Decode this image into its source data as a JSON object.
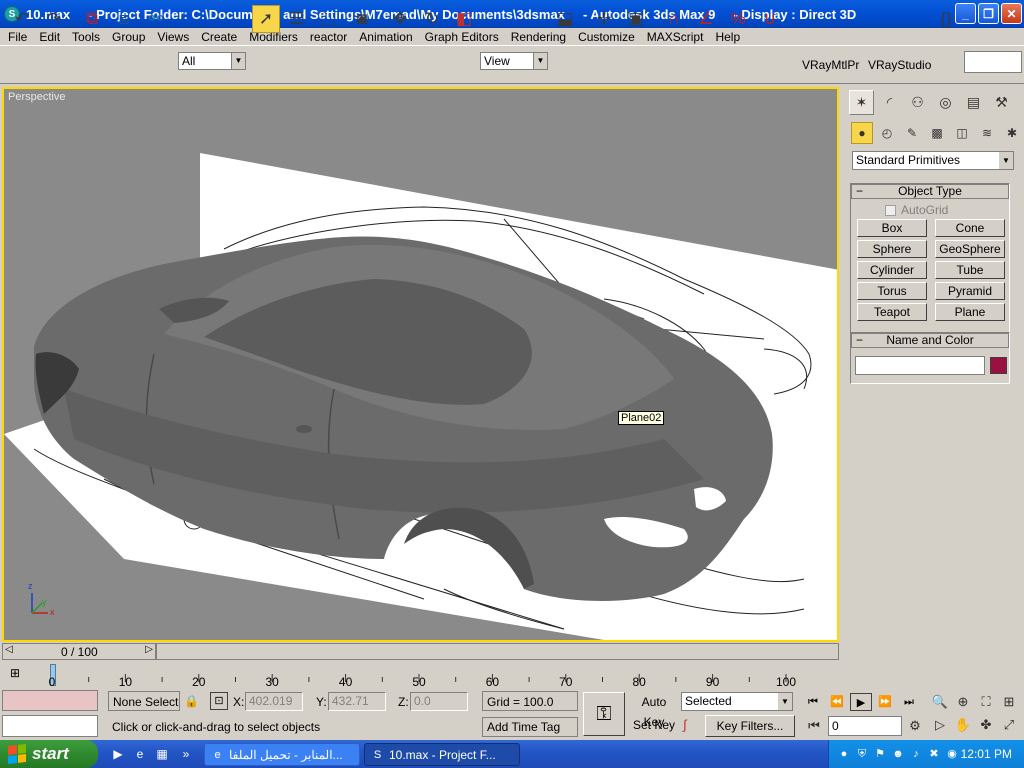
{
  "window": {
    "title": "10.max     - Project Folder: C:\\Documents and Settings\\M7emad\\My Documents\\3dsmax     - Autodesk 3ds Max 9     - Display : Direct 3D",
    "icon": "3dsmax-icon",
    "minimize": "_",
    "maximize": "❐",
    "close": "✕"
  },
  "menu": [
    "File",
    "Edit",
    "Tools",
    "Group",
    "Views",
    "Create",
    "Modifiers",
    "reactor",
    "Animation",
    "Graph Editors",
    "Rendering",
    "Customize",
    "MAXScript",
    "Help"
  ],
  "toolbar": {
    "selection_filter": "All",
    "reference_coord": "View",
    "vray_mtl": "VRayMtlPr",
    "vray_studio": "VRayStudio"
  },
  "viewport": {
    "label": "Perspective",
    "tooltip": "Plane02",
    "axis": {
      "z": "z",
      "y": "y",
      "x": "x"
    }
  },
  "command_panel": {
    "category": "Standard Primitives",
    "object_type": {
      "title": "Object Type",
      "autogrid": "AutoGrid",
      "buttons": [
        "Box",
        "Cone",
        "Sphere",
        "GeoSphere",
        "Cylinder",
        "Tube",
        "Torus",
        "Pyramid",
        "Teapot",
        "Plane"
      ]
    },
    "name_color": {
      "title": "Name and Color",
      "color": "#9a1040"
    }
  },
  "timeline": {
    "slider": "0 / 100",
    "ticks": [
      0,
      10,
      20,
      30,
      40,
      50,
      60,
      70,
      80,
      90,
      100
    ]
  },
  "status": {
    "selection": "None Selecte",
    "x_label": "X:",
    "x": "402.019",
    "y_label": "Y:",
    "y": "432.71",
    "z_label": "Z:",
    "z": "0.0",
    "grid": "Grid = 100.0",
    "prompt": "Click or click-and-drag to select objects",
    "add_time_tag": "Add Time Tag",
    "auto_key": "Auto Key",
    "set_key": "Set Key",
    "key_mode": "Selected",
    "key_filters": "Key Filters...",
    "current_frame": "0"
  },
  "taskbar": {
    "start": "start",
    "tasks": [
      {
        "label": "المنابر - تحميل الملفا...",
        "icon": "ie-icon",
        "active": false
      },
      {
        "label": "10.max     - Project F...",
        "icon": "3dsmax-icon",
        "active": true
      }
    ],
    "clock": "12:01 PM"
  }
}
